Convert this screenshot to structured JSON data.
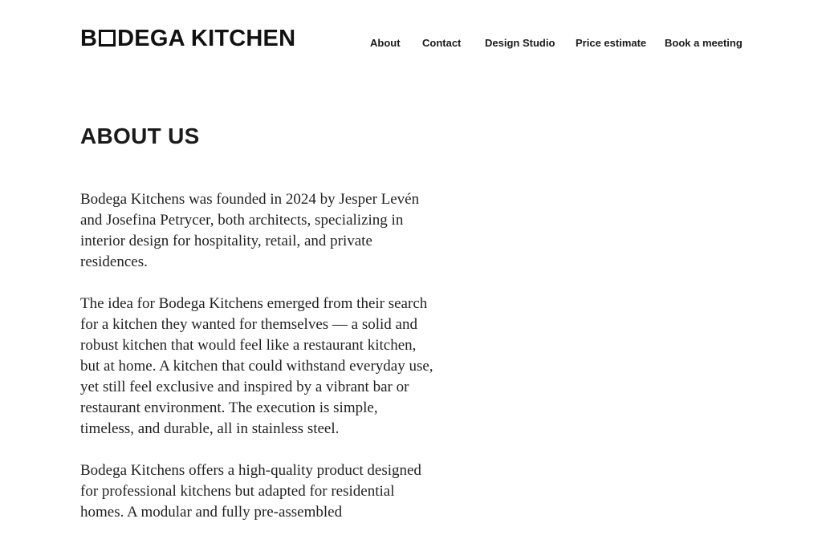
{
  "header": {
    "logo": {
      "prefix": "B",
      "suffix": "DEGA KITCHEN",
      "icon": "square-icon"
    },
    "nav": [
      {
        "label": "About"
      },
      {
        "label": "Contact"
      },
      {
        "label": "Design Studio"
      },
      {
        "label": "Price estimate"
      },
      {
        "label": "Book a meeting"
      }
    ]
  },
  "main": {
    "title": "ABOUT US",
    "paragraphs": [
      "Bodega Kitchens was founded in 2024 by Jesper Levén and Josefina Petrycer, both architects, specializing in interior design for hospitality, retail, and private residences.",
      "The idea for Bodega Kitchens emerged from their search for a kitchen they wanted for themselves — a solid and robust kitchen that would feel like a restaurant kitchen, but at home. A kitchen that could withstand everyday use, yet still feel exclusive and inspired by a vibrant bar or restaurant environment. The execution is simple, timeless, and durable, all in stainless steel.",
      "Bodega Kitchens offers a high-quality product designed for professional kitchens but adapted for residential homes. A modular and fully pre-assembled"
    ]
  }
}
